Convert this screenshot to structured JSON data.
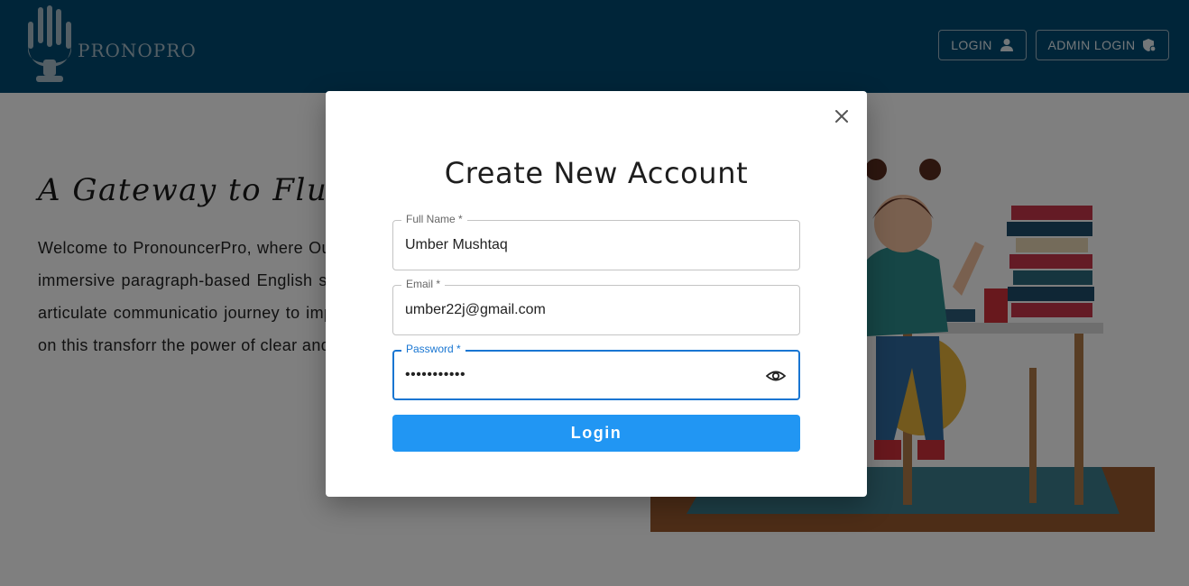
{
  "header": {
    "brand": "PRONOPRO",
    "login_label": "LOGIN",
    "admin_login_label": "ADMIN LOGIN",
    "background_color": "#004b73"
  },
  "hero": {
    "title": "A Gateway to Flue",
    "paragraph": "Welcome to PronouncerPro, where Our platform is designed to elev through immersive paragraph-based English speaker, a student honing y aiming for articulate communicatio journey to improved pronunciatio feedback. Join us on this transforr the power of clear and confident En"
  },
  "modal": {
    "title": "Create New Account",
    "full_name_label": "Full Name *",
    "full_name_value": "Umber Mushtaq",
    "email_label": "Email *",
    "email_value": "umber22j@gmail.com",
    "password_label": "Password *",
    "password_value": "•••••••••••",
    "submit_label": "Login",
    "accent_color": "#1976d2",
    "button_color": "#2196f3"
  },
  "icons": {
    "logo": "microphone-hand-icon",
    "login": "person-icon",
    "admin": "shield-user-icon",
    "close": "close-icon",
    "toggle_password": "eye-icon"
  }
}
